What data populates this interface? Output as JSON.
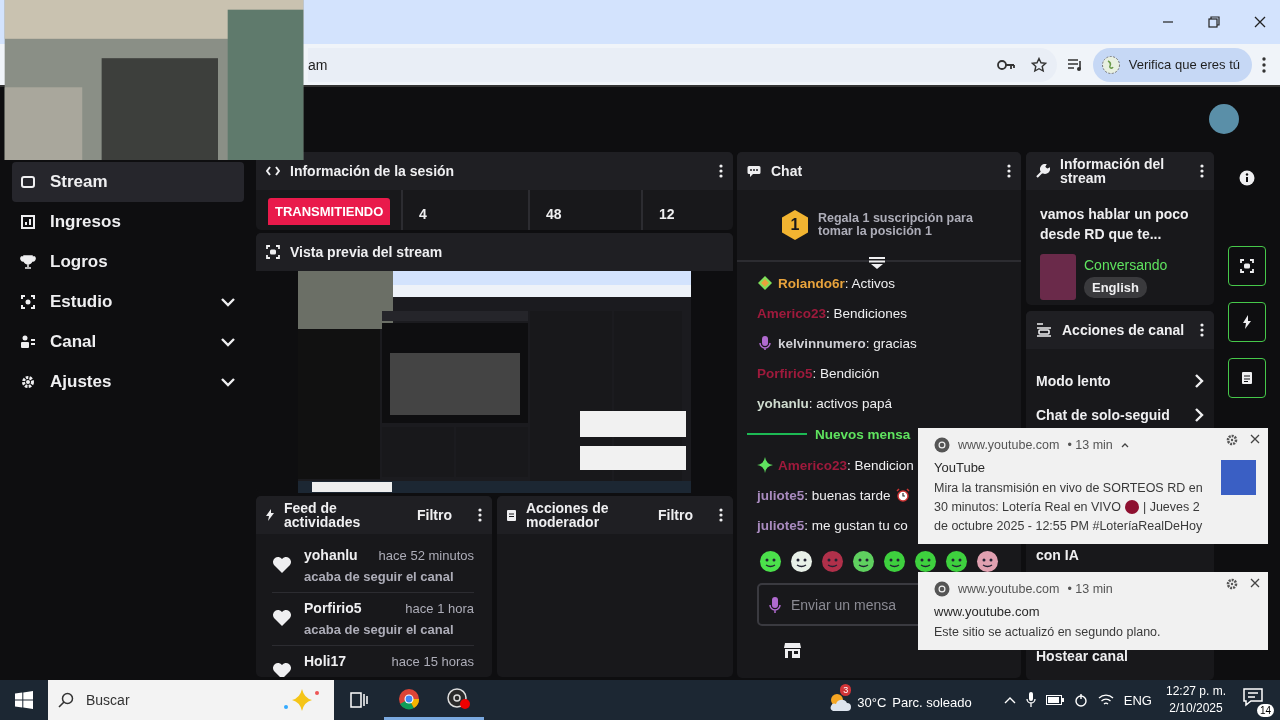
{
  "address_bar": {
    "url": "am",
    "profile_button": "Verifica que eres tú"
  },
  "sidebar": {
    "items": [
      {
        "label": "Stream",
        "selected": true,
        "expandable": false
      },
      {
        "label": "Ingresos",
        "selected": false,
        "expandable": false
      },
      {
        "label": "Logros",
        "selected": false,
        "expandable": false
      },
      {
        "label": "Estudio",
        "selected": false,
        "expandable": true
      },
      {
        "label": "Canal",
        "selected": false,
        "expandable": true
      },
      {
        "label": "Ajustes",
        "selected": false,
        "expandable": true
      }
    ]
  },
  "session_info": {
    "title": "Información de la sesión",
    "status": "TRANSMITIENDO",
    "stats": [
      "4",
      "48",
      "12"
    ]
  },
  "preview": {
    "title": "Vista previa del stream"
  },
  "activity_feed": {
    "title": "Feed de actividades",
    "filter": "Filtro",
    "items": [
      {
        "user": "yohanlu",
        "time": "hace 52 minutos",
        "action": "acaba de seguir el canal"
      },
      {
        "user": "Porfirio5",
        "time": "hace 1 hora",
        "action": "acaba de seguir el canal"
      },
      {
        "user": "Holi17",
        "time": "hace 15 horas"
      }
    ]
  },
  "mod_actions": {
    "title": "Acciones de moderador",
    "filter": "Filtro"
  },
  "chat": {
    "title": "Chat",
    "gift_rank": "1",
    "gift_text": "Regala 1 suscripción para tomar la posición 1",
    "messages": [
      {
        "kind": "diamond",
        "user": "Rolando6r",
        "text": ": Activos",
        "color": "#e8a33c"
      },
      {
        "kind": "plain",
        "user": "Americo23",
        "text": ": Bendiciones",
        "color": "#9e1a3c"
      },
      {
        "kind": "mic",
        "user": "kelvinnumero",
        "text": ": gracias",
        "color": "#cfcfd4"
      },
      {
        "kind": "plain",
        "user": "Porfirio5",
        "text": ": Bendición",
        "color": "#9e1a3c"
      },
      {
        "kind": "plain",
        "user": "yohanlu",
        "text": ": activos papá",
        "color": "#cfdccf"
      },
      {
        "kind": "divider",
        "text": "Nuevos mensa"
      },
      {
        "kind": "sparkle",
        "user": "Americo23",
        "text": ": Bendicion",
        "color": "#9e1a3c"
      },
      {
        "kind": "plain",
        "user": "juliote5",
        "text": ": buenas tarde",
        "color": "#a98bbf",
        "clock": true
      },
      {
        "kind": "plain",
        "user": "juliote5",
        "text": ": me gustan tu co",
        "color": "#a98bbf"
      }
    ],
    "input_placeholder": "Enviar un mensa"
  },
  "stream_info": {
    "title": "Información del stream",
    "stream_title": "vamos hablar un poco desde RD que te...",
    "category": "Conversando",
    "tag": "English"
  },
  "channel_actions": {
    "title": "Acciones de canal",
    "items": [
      {
        "label": "Modo lento",
        "arrow": true
      },
      {
        "label": "Chat de solo-seguid",
        "arrow": true
      },
      {
        "label": "con IA",
        "arrow": false
      },
      {
        "label": "Hostear canal",
        "arrow": false
      }
    ]
  },
  "notifications": [
    {
      "source": "www.youtube.com",
      "age": "• 13 min",
      "expanded": true,
      "thumbnail": true,
      "title": "YouTube",
      "body_lines": [
        [
          "Mira la transmisión en vivo de SORTEOS RD en"
        ],
        [
          "30 minutos: Lotería Real en VIVO",
          "| Jueves 2"
        ],
        [
          "de octubre 2025 - 12:55 PM #LoteríaRealDeHoy"
        ]
      ]
    },
    {
      "source": "www.youtube.com",
      "age": "• 13 min",
      "expanded": false,
      "thumbnail": false,
      "title": "www.youtube.com",
      "body_lines": [
        [
          "Este sitio se actualizó en segundo plano."
        ]
      ]
    }
  ],
  "taskbar": {
    "search_placeholder": "Buscar",
    "weather_badge": "3",
    "temperature": "30°C",
    "condition": "Parc. soleado",
    "language": "ENG",
    "time": "12:27 p. m.",
    "date": "2/10/2025",
    "notification_count": "14"
  }
}
